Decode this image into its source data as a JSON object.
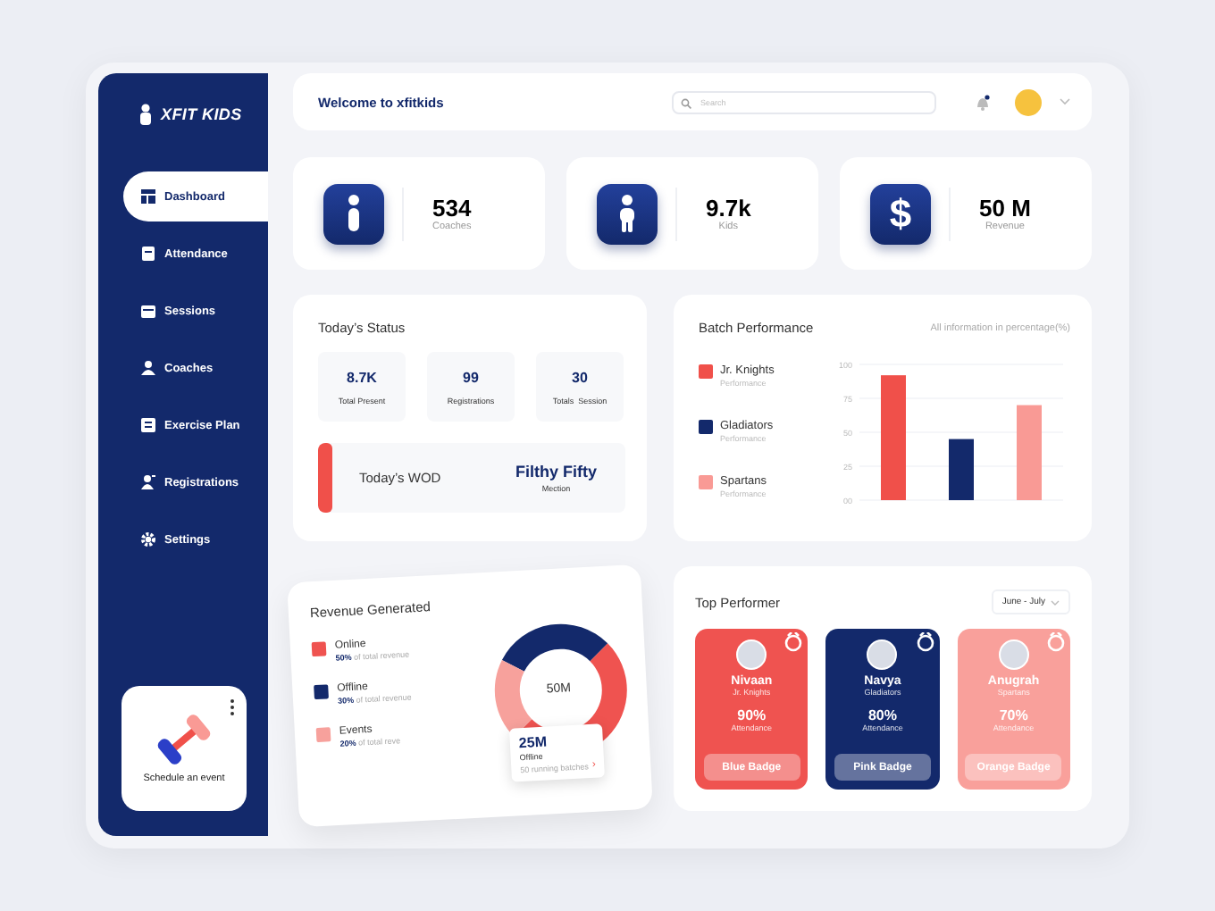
{
  "sidebar": {
    "logo": "XFIT KIDS",
    "items": [
      {
        "label": "Dashboard",
        "selected": true
      },
      {
        "label": "Attendance",
        "selected": false
      },
      {
        "label": "Sessions",
        "selected": false
      },
      {
        "label": "Coaches",
        "selected": false
      },
      {
        "label": "Exercise Plan",
        "selected": false
      },
      {
        "label": "Registrations",
        "selected": false
      },
      {
        "label": "Settings",
        "selected": false
      }
    ],
    "event_card": {
      "label": "Schedule an event"
    }
  },
  "header": {
    "title": "Welcome to xfitkids",
    "search": {
      "placeholder": "Search"
    }
  },
  "stats": [
    {
      "kind": "coach",
      "value": "534",
      "label": "Coaches"
    },
    {
      "kind": "kid",
      "value": "9.7k",
      "label": "Kids"
    },
    {
      "kind": "money",
      "symbol": "$",
      "value": "50 M",
      "label": "Revenue"
    }
  ],
  "todays_status": {
    "title": "Today’s Status",
    "items": [
      {
        "value": "8.7K",
        "label": "Total Present"
      },
      {
        "value": "99",
        "label": "Registrations"
      },
      {
        "value": "30",
        "label": "Totals  Session"
      }
    ],
    "wod": {
      "label": "Today’s WOD",
      "name": "Filthy Fifty",
      "subtitle": "Mection"
    }
  },
  "batch_performance": {
    "title": "Batch Performance",
    "note": "All information in percentage(%)",
    "legend_captions": [
      "Performance",
      "Performance",
      "Performance"
    ],
    "chart_data": {
      "type": "bar",
      "grid": true,
      "ylim": [
        0,
        100
      ],
      "yticks": [
        {
          "value": 0,
          "label": "00"
        },
        25,
        50,
        75,
        100
      ],
      "series": [
        {
          "name": "Jr. Knights",
          "color": "#f0504a",
          "values": [
            92
          ]
        },
        {
          "name": "Gladiators",
          "color": "#13296b",
          "values": [
            45
          ]
        },
        {
          "name": "Spartans",
          "color": "#f99a95",
          "values": [
            70
          ]
        }
      ]
    }
  },
  "revenue": {
    "title": "Revenue Generated",
    "center": "50M",
    "legend_texts": [
      "**50%** of total revenue",
      "**30%** of total revenue",
      "**20%** of total reve"
    ],
    "chart_data": {
      "type": "donut",
      "categories": [
        "Online",
        "Offline",
        "Events"
      ],
      "series": [
        {
          "colors": [
            "#ef5350",
            "#13296b",
            "#f7a19c"
          ],
          "values": [
            50,
            30,
            20
          ]
        }
      ]
    },
    "tooltip": {
      "value": "25M",
      "label": "Offline",
      "detail": "50 running batches",
      "arrow": "›"
    }
  },
  "top_performer": {
    "title": "Top Performer",
    "period": "June - July",
    "cards": [
      {
        "name": "Nivaan",
        "team": "Jr. Knights",
        "percent": "90%",
        "caption": "Attendance",
        "badge": "Blue Badge",
        "color": "#ef5350"
      },
      {
        "name": "Navya",
        "team": "Gladiators",
        "percent": "80%",
        "caption": "Attendance",
        "badge": "Pink Badge",
        "color": "#13296b"
      },
      {
        "name": "Anugrah",
        "team": "Spartans",
        "percent": "70%",
        "caption": "Attendance",
        "badge": "Orange Badge",
        "color": "#f9a09b"
      }
    ]
  }
}
